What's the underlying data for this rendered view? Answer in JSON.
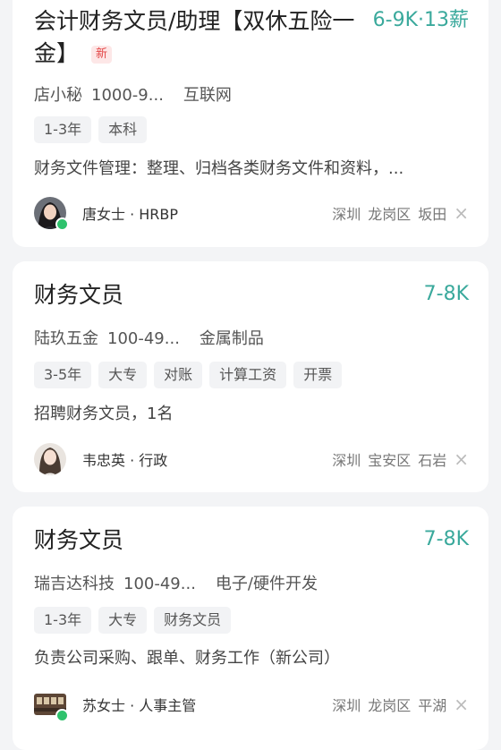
{
  "jobs": [
    {
      "title": "会计财务文员/助理【双休五险一金】",
      "badge": "新",
      "salary": "6-9K·13薪",
      "company": "店小秘",
      "size": "1000-9...",
      "industry": "互联网",
      "tags": [
        "1-3年",
        "本科"
      ],
      "description": "财务文件管理：整理、归档各类财务文件和资料，...",
      "recruiter": "唐女士 · HRBP",
      "online": true,
      "location": [
        "深圳",
        "龙岗区",
        "坂田"
      ],
      "avatar_icon": "avatar-woman-dark-hair-icon"
    },
    {
      "title": "财务文员",
      "salary": "7-8K",
      "company": "陆玖五金",
      "size": "100-49...",
      "industry": "金属制品",
      "tags": [
        "3-5年",
        "大专",
        "对账",
        "计算工资",
        "开票"
      ],
      "description": "招聘财务文员，1名",
      "recruiter": "韦忠英 · 行政",
      "online": false,
      "location": [
        "深圳",
        "宝安区",
        "石岩"
      ],
      "avatar_icon": "avatar-woman-portrait-icon"
    },
    {
      "title": "财务文员",
      "salary": "7-8K",
      "company": "瑞吉达科技",
      "size": "100-49...",
      "industry": "电子/硬件开发",
      "tags": [
        "1-3年",
        "大专",
        "财务文员"
      ],
      "description": "负责公司采购、跟单、财务工作（新公司）",
      "recruiter": "苏女士 · 人事主管",
      "online": true,
      "location": [
        "深圳",
        "龙岗区",
        "平湖"
      ],
      "avatar_icon": "avatar-office-building-icon"
    }
  ],
  "colors": {
    "salary": "#3aa99c",
    "background": "#f3f4f6",
    "card": "#ffffff",
    "tag_bg": "#f2f3f5",
    "online": "#2fc26d",
    "new_badge_bg": "#fde7e7",
    "new_badge_text": "#e34848"
  },
  "icons": {
    "dismiss": "×"
  }
}
